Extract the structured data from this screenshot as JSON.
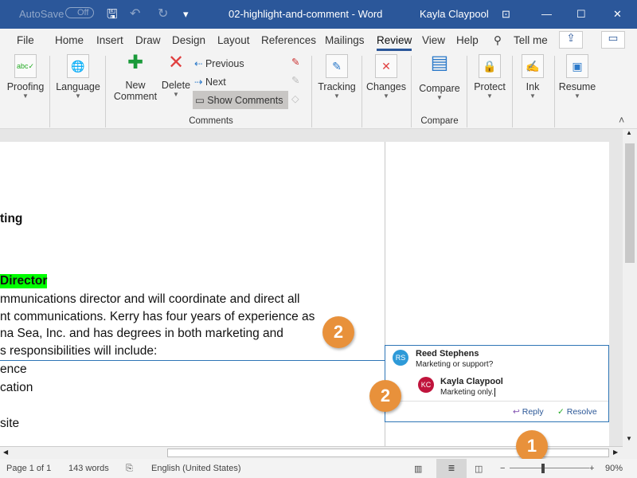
{
  "titlebar": {
    "autosave": "AutoSave",
    "toggle": "Off",
    "title": "02-highlight-and-comment - Word",
    "user": "Kayla Claypool"
  },
  "tabs": [
    "File",
    "Home",
    "Insert",
    "Draw",
    "Design",
    "Layout",
    "References",
    "Mailings",
    "Review",
    "View",
    "Help",
    "Tell me"
  ],
  "active_tab": "Review",
  "ribbon": {
    "proofing": "Proofing",
    "language": "Language",
    "new_comment": [
      "New",
      "Comment"
    ],
    "delete": "Delete",
    "previous": "Previous",
    "next": "Next",
    "show_comments": "Show Comments",
    "comments_group": "Comments",
    "tracking": "Tracking",
    "changes": "Changes",
    "compare": "Compare",
    "compare_group": "Compare",
    "protect": "Protect",
    "ink": "Ink",
    "resume": "Resume"
  },
  "document": {
    "lines": [
      "ting",
      "Director",
      "mmunications director and will coordinate and direct all",
      "nt communications. Kerry has four years of experience as",
      "na Sea, Inc. and has degrees in both marketing and",
      "s responsibilities will include:",
      "ence",
      "cation",
      "site"
    ],
    "highlight_color": "#00ff00"
  },
  "comments": {
    "first": {
      "initials": "RS",
      "author": "Reed Stephens",
      "text": "Marketing or support?",
      "color": "#2e9ad8"
    },
    "reply": {
      "initials": "KC",
      "author": "Kayla Claypool",
      "text": "Marketing only.",
      "color": "#c0143c"
    },
    "reply_label": "Reply",
    "resolve_label": "Resolve"
  },
  "callouts": [
    "2",
    "2",
    "1"
  ],
  "status": {
    "page": "Page 1 of 1",
    "words": "143 words",
    "language": "English (United States)",
    "zoom": "90%",
    "zoom_level": 90
  }
}
